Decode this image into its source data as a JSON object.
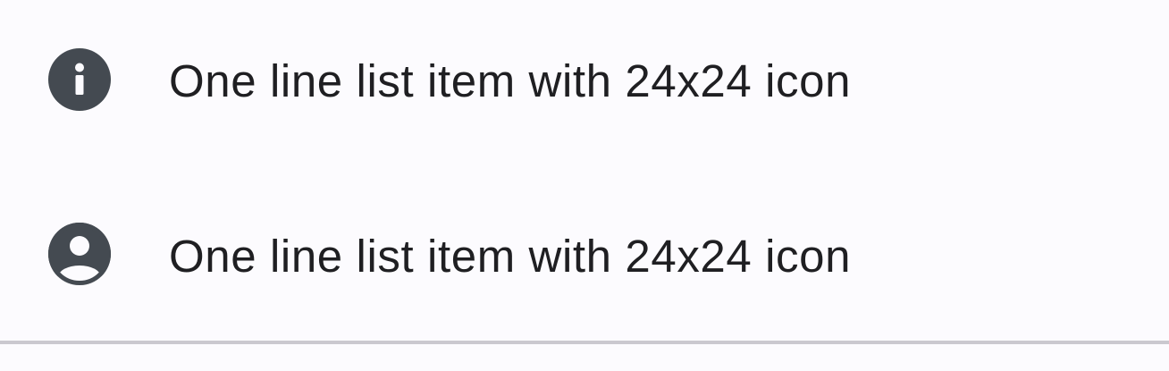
{
  "list": {
    "items": [
      {
        "label": "One line list item with 24x24 icon",
        "icon": "info-icon"
      },
      {
        "label": "One line list item with 24x24 icon",
        "icon": "account-circle-icon"
      }
    ]
  },
  "colors": {
    "background": "#fcfbfe",
    "text": "#1f1f22",
    "icon": "#444a51",
    "divider": "#cac8cf"
  }
}
